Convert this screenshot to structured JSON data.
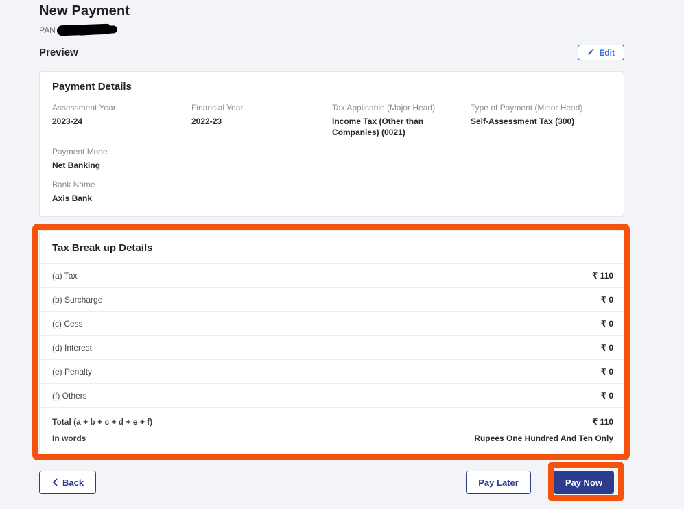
{
  "page": {
    "title": "New Payment",
    "pan_label": "PAN"
  },
  "preview": {
    "heading": "Preview",
    "edit_label": "Edit"
  },
  "payment_details": {
    "heading": "Payment Details",
    "fields": [
      {
        "label": "Assessment Year",
        "value": "2023-24"
      },
      {
        "label": "Financial Year",
        "value": "2022-23"
      },
      {
        "label": "Tax Applicable (Major Head)",
        "value": "Income Tax (Other than Companies) (0021)"
      },
      {
        "label": "Type of Payment (Minor Head)",
        "value": "Self-Assessment Tax (300)"
      },
      {
        "label": "Payment Mode",
        "value": "Net Banking"
      },
      {
        "label": "Bank Name",
        "value": "Axis Bank"
      }
    ]
  },
  "tax_breakup": {
    "heading": "Tax Break up Details",
    "rows": [
      {
        "label": "(a) Tax",
        "amount": "₹ 110"
      },
      {
        "label": "(b) Surcharge",
        "amount": "₹ 0"
      },
      {
        "label": "(c) Cess",
        "amount": "₹ 0"
      },
      {
        "label": "(d) Interest",
        "amount": "₹ 0"
      },
      {
        "label": "(e) Penalty",
        "amount": "₹ 0"
      },
      {
        "label": "(f) Others",
        "amount": "₹ 0"
      }
    ],
    "total": {
      "label": "Total (a + b + c + d + e + f)",
      "amount": "₹ 110"
    },
    "in_words": {
      "label": "In words",
      "value": "Rupees One Hundred And Ten Only"
    }
  },
  "footer": {
    "back_label": "Back",
    "pay_later_label": "Pay Later",
    "pay_now_label": "Pay Now"
  },
  "colors": {
    "navy": "#2c3d8f",
    "edit_blue": "#2e6ae0",
    "annotation_orange": "#f4520d",
    "page_background": "#f2f4f8"
  }
}
